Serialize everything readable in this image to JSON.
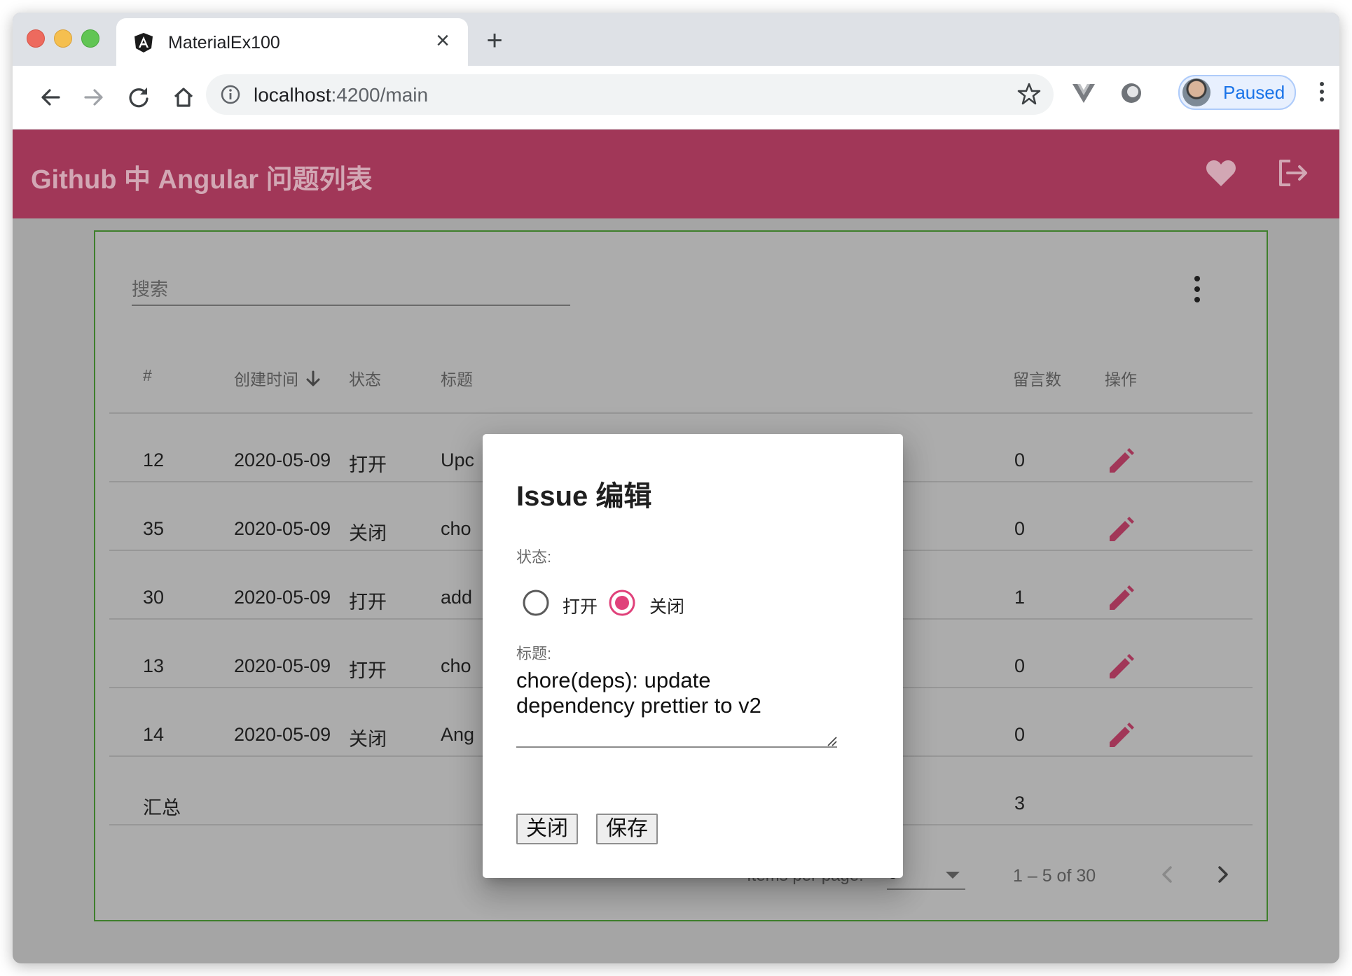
{
  "browser": {
    "tab_title": "MaterialEx100",
    "url_host": "localhost",
    "url_rest": ":4200/main",
    "profile_label": "Paused"
  },
  "app": {
    "title": "Github 中 Angular 问题列表",
    "icons": [
      "heart-icon",
      "logout-icon"
    ],
    "accent_color": "#a13758"
  },
  "search": {
    "placeholder": "搜索"
  },
  "table": {
    "headers": {
      "number": "#",
      "created": "创建时间",
      "state": "状态",
      "title": "标题",
      "comments": "留言数",
      "actions": "操作"
    },
    "sort_column": "created",
    "sort_direction": "descending",
    "rows": [
      {
        "number": "12",
        "created": "2020-05-09",
        "state": "打开",
        "title": "Upc",
        "comments": "0"
      },
      {
        "number": "35",
        "created": "2020-05-09",
        "state": "关闭",
        "title": "cho",
        "comments": "0"
      },
      {
        "number": "30",
        "created": "2020-05-09",
        "state": "打开",
        "title": "add",
        "comments": "1"
      },
      {
        "number": "13",
        "created": "2020-05-09",
        "state": "打开",
        "title": "cho",
        "comments": "0"
      },
      {
        "number": "14",
        "created": "2020-05-09",
        "state": "关闭",
        "title": "Ang",
        "comments": "0"
      }
    ],
    "footer": {
      "label": "汇总",
      "comments_total": "3"
    }
  },
  "paginator": {
    "items_per_page_label": "Items per page:",
    "page_size": "5",
    "range_label": "1 – 5 of 30"
  },
  "dialog": {
    "title": "Issue 编辑",
    "state_label": "状态:",
    "state_options": [
      "打开",
      "关闭"
    ],
    "selected_state": "关闭",
    "title_label": "标题:",
    "title_value": "chore(deps): update\ndependency prettier to v2",
    "close_button": "关闭",
    "save_button": "保存"
  }
}
